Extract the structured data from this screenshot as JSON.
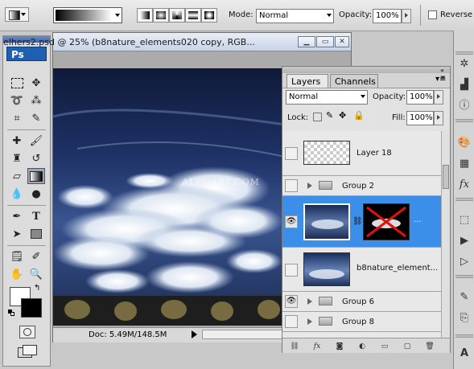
{
  "options_bar": {
    "mode_label": "Mode:",
    "mode_value": "Normal",
    "opacity_label": "Opacity:",
    "opacity_value": "100%",
    "reverse_label": "Reverse"
  },
  "toolbox": {
    "logo": "Ps"
  },
  "document": {
    "title": "elhers2.psd @ 25% (b8nature_elements020 copy, RGB...",
    "watermark": "ALFOART.COM",
    "status": "Doc: 5.49M/148.5M"
  },
  "layers_panel": {
    "tabs": [
      "Layers",
      "Channels"
    ],
    "blend_mode": "Normal",
    "opacity_label": "Opacity:",
    "opacity_value": "100%",
    "lock_label": "Lock:",
    "fill_label": "Fill:",
    "fill_value": "100%",
    "layers": [
      {
        "name": "Layer 18",
        "visible": false,
        "type": "layer"
      },
      {
        "name": "Group 2",
        "visible": false,
        "type": "group"
      },
      {
        "name": "",
        "visible": true,
        "type": "masked-layer",
        "selected": true,
        "more": "..."
      },
      {
        "name": "b8nature_element...",
        "visible": false,
        "type": "layer"
      },
      {
        "name": "Group 6",
        "visible": true,
        "type": "group"
      },
      {
        "name": "Group 8",
        "visible": false,
        "type": "group"
      }
    ]
  },
  "colors": {
    "selection": "#3c8fe8",
    "logo_bg": "#1f5fb2"
  }
}
